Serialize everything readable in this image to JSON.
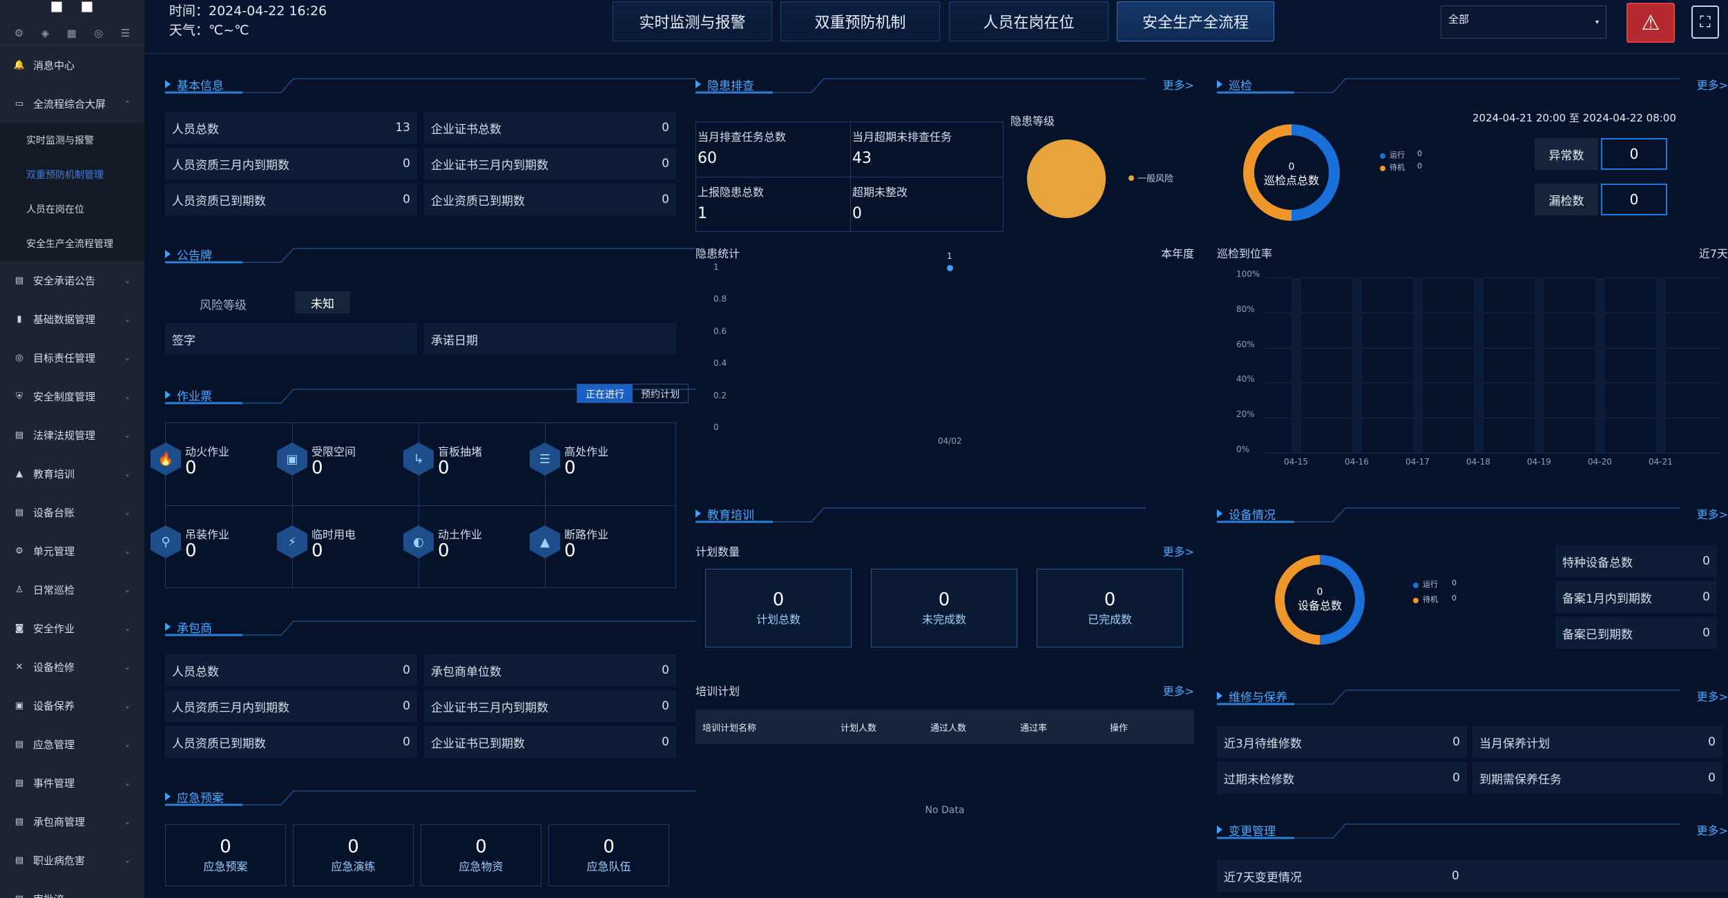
{
  "sidebar": {
    "icons": [
      "gear-icon",
      "apps-icon",
      "grid-icon",
      "target-icon",
      "sliders-icon"
    ],
    "items": [
      {
        "label": "消息中心",
        "icon": "bell-icon",
        "glyph": "🔔",
        "expanded": false,
        "chevron": ""
      },
      {
        "label": "全流程综合大屏",
        "icon": "monitor-icon",
        "glyph": "▭",
        "expanded": true,
        "chevron": "⌃"
      },
      {
        "label": "安全承诺公告",
        "icon": "doc-icon",
        "glyph": "▤",
        "chevron": "⌄"
      },
      {
        "label": "基础数据管理",
        "icon": "bar-icon",
        "glyph": "▮",
        "chevron": "⌄"
      },
      {
        "label": "目标责任管理",
        "icon": "target-icon",
        "glyph": "◎",
        "chevron": "⌄"
      },
      {
        "label": "安全制度管理",
        "icon": "shield-icon",
        "glyph": "⛨",
        "chevron": "⌄"
      },
      {
        "label": "法律法规管理",
        "icon": "book-icon",
        "glyph": "▤",
        "chevron": "⌄"
      },
      {
        "label": "教育培训",
        "icon": "cap-icon",
        "glyph": "▲",
        "chevron": "⌄"
      },
      {
        "label": "设备台账",
        "icon": "ledger-icon",
        "glyph": "▤",
        "chevron": "⌄"
      },
      {
        "label": "单元管理",
        "icon": "gear-icon",
        "glyph": "⚙",
        "chevron": "⌄"
      },
      {
        "label": "日常巡检",
        "icon": "walk-icon",
        "glyph": "♙",
        "chevron": "⌄"
      },
      {
        "label": "安全作业",
        "icon": "camera-icon",
        "glyph": "◙",
        "chevron": "⌄"
      },
      {
        "label": "设备检修",
        "icon": "wrench-icon",
        "glyph": "✕",
        "chevron": "⌄"
      },
      {
        "label": "设备保养",
        "icon": "save-icon",
        "glyph": "▣",
        "chevron": "⌄"
      },
      {
        "label": "应急管理",
        "icon": "list-icon",
        "glyph": "▤",
        "chevron": "⌄"
      },
      {
        "label": "事件管理",
        "icon": "tag-icon",
        "glyph": "▤",
        "chevron": "⌄"
      },
      {
        "label": "承包商管理",
        "icon": "card-icon",
        "glyph": "▤",
        "chevron": "⌄"
      },
      {
        "label": "职业病危害",
        "icon": "alert-icon",
        "glyph": "▤",
        "chevron": "⌄"
      },
      {
        "label": "审批流",
        "icon": "flow-icon",
        "glyph": "▤",
        "chevron": "⌄"
      }
    ],
    "subitems": [
      {
        "label": "实时监测与报警",
        "active": false
      },
      {
        "label": "双重预防机制管理",
        "active": true
      },
      {
        "label": "人员在岗在位",
        "active": false
      },
      {
        "label": "安全生产全流程管理",
        "active": false
      }
    ]
  },
  "header": {
    "time": "时间：2024-04-22 16:26",
    "weather": "天气：℃~℃",
    "tabs": [
      "实时监测与报警",
      "双重预防机制",
      "人员在岗在位",
      "安全生产全流程"
    ],
    "active_tab": 3,
    "select_value": "全部",
    "select_arrow": "▾",
    "alarm_glyph": "⚠",
    "fullscreen_glyph": "⛶"
  },
  "more": "更多>",
  "basic": {
    "title": "基本信息",
    "rows": [
      {
        "l": "人员总数",
        "lv": "13",
        "r": "企业证书总数",
        "rv": "0"
      },
      {
        "l": "人员资质三月内到期数",
        "lv": "0",
        "r": "企业证书三月内到期数",
        "rv": "0"
      },
      {
        "l": "人员资质已到期数",
        "lv": "0",
        "r": "企业资质已到期数",
        "rv": "0"
      }
    ]
  },
  "notice": {
    "title": "公告牌",
    "risk_label": "风险等级",
    "risk_value": "未知",
    "sign": "签字",
    "date": "承诺日期"
  },
  "work": {
    "title": "作业票",
    "tab_active": "正在进行",
    "tab_other": "预约计划",
    "items": [
      {
        "label": "动火作业",
        "value": "0",
        "icon": "fire-icon",
        "glyph": "🔥"
      },
      {
        "label": "受限空间",
        "value": "0",
        "icon": "cube-icon",
        "glyph": "▣"
      },
      {
        "label": "盲板抽堵",
        "value": "0",
        "icon": "pipe-icon",
        "glyph": "↳"
      },
      {
        "label": "高处作业",
        "value": "0",
        "icon": "ladder-icon",
        "glyph": "☰"
      },
      {
        "label": "吊装作业",
        "value": "0",
        "icon": "hook-icon",
        "glyph": "⚲"
      },
      {
        "label": "临时用电",
        "value": "0",
        "icon": "bolt-icon",
        "glyph": "⚡"
      },
      {
        "label": "动土作业",
        "value": "0",
        "icon": "shovel-icon",
        "glyph": "◐"
      },
      {
        "label": "断路作业",
        "value": "0",
        "icon": "cone-icon",
        "glyph": "▲"
      }
    ]
  },
  "contractor": {
    "title": "承包商",
    "rows": [
      {
        "l": "人员总数",
        "lv": "0",
        "r": "承包商单位数",
        "rv": "0"
      },
      {
        "l": "人员资质三月内到期数",
        "lv": "0",
        "r": "企业证书三月内到期数",
        "rv": "0"
      },
      {
        "l": "人员资质已到期数",
        "lv": "0",
        "r": "企业证书已到期数",
        "rv": "0"
      }
    ]
  },
  "emergency": {
    "title": "应急预案",
    "boxes": [
      {
        "v": "0",
        "l": "应急预案"
      },
      {
        "v": "0",
        "l": "应急演练"
      },
      {
        "v": "0",
        "l": "应急物资"
      },
      {
        "v": "0",
        "l": "应急队伍"
      }
    ]
  },
  "hazard": {
    "title": "隐患排查",
    "cells": [
      {
        "l": "当月排查任务总数",
        "v": "60"
      },
      {
        "l": "当月超期未排查任务",
        "v": "43"
      },
      {
        "l": "上报隐患总数",
        "v": "1"
      },
      {
        "l": "超期未整改",
        "v": "0"
      }
    ],
    "level_title": "隐患等级",
    "legend": "一般风险",
    "pie_color": "#e8a43c",
    "stat_title": "隐患统计",
    "stat_period": "本年度"
  },
  "hazard_chart": {
    "type": "scatter",
    "x": [
      "04/02"
    ],
    "values": [
      1
    ],
    "point_label": "1",
    "yticks": [
      "1",
      "0.8",
      "0.6",
      "0.4",
      "0.2",
      "0"
    ],
    "ylim": [
      0,
      1
    ]
  },
  "patrol": {
    "title": "巡检",
    "donut_value": "0",
    "donut_label": "巡检点总数",
    "legend": [
      {
        "name": "运行",
        "value": "0",
        "color": "#1a6fd8"
      },
      {
        "name": "待机",
        "value": "0",
        "color": "#f0972b"
      }
    ],
    "range": "2024-04-21 20:00 至 2024-04-22 08:00",
    "abnormal_label": "异常数",
    "abnormal_value": "0",
    "miss_label": "漏检数",
    "miss_value": "0",
    "rate_title": "巡检到位率",
    "rate_period": "近7天"
  },
  "patrol_chart": {
    "type": "bar",
    "categories": [
      "04-15",
      "04-16",
      "04-17",
      "04-18",
      "04-19",
      "04-20",
      "04-21"
    ],
    "values": [
      0,
      0,
      0,
      0,
      0,
      0,
      0
    ],
    "yticks": [
      "100%",
      "80%",
      "60%",
      "40%",
      "20%",
      "0%"
    ],
    "ylim": [
      0,
      100
    ]
  },
  "edu": {
    "title": "教育培训",
    "plan_count": "计划数量",
    "boxes": [
      {
        "v": "0",
        "l": "计划总数"
      },
      {
        "v": "0",
        "l": "未完成数"
      },
      {
        "v": "0",
        "l": "已完成数"
      }
    ],
    "plan_title": "培训计划",
    "cols": [
      "培训计划名称",
      "计划人数",
      "通过人数",
      "通过率",
      "操作"
    ],
    "empty": "No Data"
  },
  "device": {
    "title": "设备情况",
    "donut_value": "0",
    "donut_label": "设备总数",
    "legend": [
      {
        "name": "运行",
        "value": "0",
        "color": "#1a6fd8"
      },
      {
        "name": "待机",
        "value": "0",
        "color": "#f0972b"
      }
    ],
    "rows": [
      {
        "l": "特种设备总数",
        "v": "0"
      },
      {
        "l": "备案1月内到期数",
        "v": "0"
      },
      {
        "l": "备案已到期数",
        "v": "0"
      }
    ]
  },
  "maint": {
    "title": "维修与保养",
    "rows": [
      {
        "l": "近3月待维修数",
        "lv": "0",
        "r": "当月保养计划",
        "rv": "0"
      },
      {
        "l": "过期未检修数",
        "lv": "0",
        "r": "到期需保养任务",
        "rv": "0"
      }
    ]
  },
  "change": {
    "title": "变更管理",
    "row_label": "近7天变更情况",
    "row_value": "0"
  }
}
